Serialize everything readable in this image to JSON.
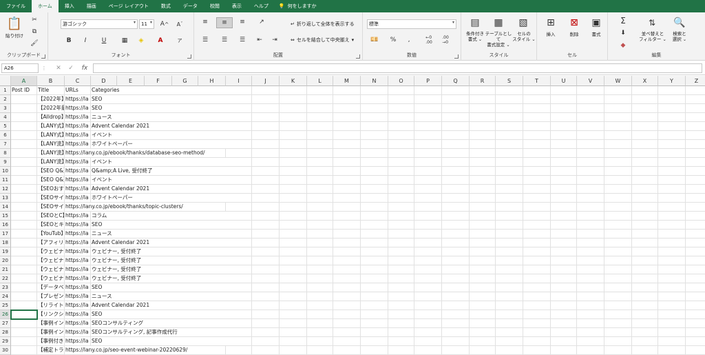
{
  "tabs": [
    "ファイル",
    "ホーム",
    "挿入",
    "描画",
    "ページ レイアウト",
    "数式",
    "データ",
    "校閲",
    "表示",
    "ヘルプ"
  ],
  "tell_me": "何をしますか",
  "ribbon": {
    "clipboard": {
      "paste": "貼り付け",
      "label": "クリップボード"
    },
    "font": {
      "name": "游ゴシック",
      "size": "11",
      "label": "フォント"
    },
    "alignment": {
      "wrap": "折り返して全体を表示する",
      "merge": "セルを結合して中央揃え",
      "label": "配置"
    },
    "number": {
      "format": "標準",
      "label": "数値"
    },
    "styles": {
      "cond": "条件付き\n書式 ⌄",
      "table": "テーブルとして\n書式設定 ⌄",
      "cellstyle": "セルの\nスタイル ⌄",
      "label": "スタイル"
    },
    "cells": {
      "insert": "挿入",
      "delete": "削除",
      "format": "書式",
      "label": "セル"
    },
    "editing": {
      "sigma": "Σ",
      "sort": "並べ替えと\nフィルター ⌄",
      "find": "検索と\n選択 ⌄",
      "label": "編集"
    }
  },
  "formula_bar": {
    "name_box": "A26",
    "fx": "fx",
    "value": ""
  },
  "columns": [
    "A",
    "B",
    "C",
    "D",
    "E",
    "F",
    "G",
    "H",
    "I",
    "J",
    "K",
    "L",
    "M",
    "N",
    "O",
    "P",
    "Q",
    "R",
    "S",
    "T",
    "U",
    "V",
    "W",
    "X",
    "Y",
    "Z"
  ],
  "selected_cell": {
    "col": "A",
    "row": 26
  },
  "rows": [
    [
      "Post ID",
      "Title",
      "URLs",
      "Categories"
    ],
    [
      "",
      "【2022年】",
      "https://la",
      "SEO"
    ],
    [
      "",
      "【2022年最",
      "https://la",
      "SEO"
    ],
    [
      "",
      "【Alldrop】",
      "https://la",
      "ニュース"
    ],
    [
      "",
      "【LANY式】",
      "https://la",
      "Advent Calendar 2021"
    ],
    [
      "",
      "【LANY式】",
      "https://la",
      "イベント"
    ],
    [
      "",
      "【LANY流】",
      "https://la",
      "ホワイトペーパー"
    ],
    [
      "",
      "【LANY流】",
      "https://lany.co.jp/ebook/thanks/database-seo-method/",
      ""
    ],
    [
      "",
      "【LANY流】",
      "https://la",
      "イベント"
    ],
    [
      "",
      "【SEO Q&】",
      "https://la",
      "Q&amp;A Live, 受付終了"
    ],
    [
      "",
      "【SEO Q&】",
      "https://la",
      "イベント"
    ],
    [
      "",
      "【SEOおす】",
      "https://la",
      "Advent Calendar 2021"
    ],
    [
      "",
      "【SEOサイ】",
      "https://la",
      "ホワイトペーパー"
    ],
    [
      "",
      "【SEOサイ】",
      "https://lany.co.jp/ebook/thanks/topic-clusters/",
      ""
    ],
    [
      "",
      "【SEOとC】",
      "https://la",
      "コラム"
    ],
    [
      "",
      "【SEOとキ】",
      "https://la",
      "SEO"
    ],
    [
      "",
      "【YouTub】",
      "https://la",
      "ニュース"
    ],
    [
      "",
      "【アフィリ】",
      "https://la",
      "Advent Calendar 2021"
    ],
    [
      "",
      "【ウェビナ】",
      "https://la",
      "ウェビナー, 受付終了"
    ],
    [
      "",
      "【ウェビナ】",
      "https://la",
      "ウェビナー, 受付終了"
    ],
    [
      "",
      "【ウェビナ】",
      "https://la",
      "ウェビナー, 受付終了"
    ],
    [
      "",
      "【ウェビナ】",
      "https://la",
      "ウェビナー, 受付終了"
    ],
    [
      "",
      "【データベ】",
      "https://la",
      "SEO"
    ],
    [
      "",
      "【プレゼン】",
      "https://la",
      "ニュース"
    ],
    [
      "",
      "【リライト】",
      "https://la",
      "Advent Calendar 2021"
    ],
    [
      "",
      "【リンクシ】",
      "https://la",
      "SEO"
    ],
    [
      "",
      "【事例イン】",
      "https://la",
      "SEOコンサルティング"
    ],
    [
      "",
      "【事例イン】",
      "https://la",
      "SEOコンサルティング, 記事作成代行"
    ],
    [
      "",
      "【事例付き】",
      "https://la",
      "SEO"
    ],
    [
      "",
      "【補定トラ】",
      "https://lany.co.jp/seo-event-webinar-20220629/",
      ""
    ]
  ]
}
